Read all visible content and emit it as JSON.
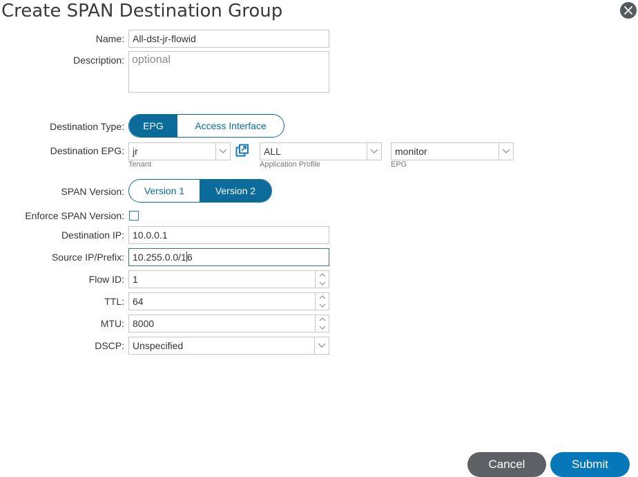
{
  "dialog": {
    "title": "Create SPAN Destination Group"
  },
  "form": {
    "name": {
      "label": "Name:",
      "value": "All-dst-jr-flowid"
    },
    "description": {
      "label": "Description:",
      "placeholder": "optional"
    },
    "destination_type": {
      "label": "Destination Type:",
      "options": [
        "EPG",
        "Access Interface"
      ],
      "selected": "EPG"
    },
    "destination_epg": {
      "label": "Destination EPG:",
      "tenant": {
        "value": "jr",
        "sublabel": "Tenant"
      },
      "app_profile": {
        "value": "ALL",
        "sublabel": "Application Profile"
      },
      "epg": {
        "value": "monitor",
        "sublabel": "EPG"
      }
    },
    "span_version": {
      "label": "SPAN Version:",
      "options": [
        "Version 1",
        "Version 2"
      ],
      "selected": "Version 2"
    },
    "enforce_span_version": {
      "label": "Enforce SPAN Version:",
      "checked": false
    },
    "destination_ip": {
      "label": "Destination IP:",
      "value": "10.0.0.1"
    },
    "source_ip_prefix": {
      "label": "Source IP/Prefix:",
      "value_before_cursor": "10.255.0.0/1",
      "value_after_cursor": "6"
    },
    "flow_id": {
      "label": "Flow ID:",
      "value": "1"
    },
    "ttl": {
      "label": "TTL:",
      "value": "64"
    },
    "mtu": {
      "label": "MTU:",
      "value": "8000"
    },
    "dscp": {
      "label": "DSCP:",
      "value": "Unspecified"
    }
  },
  "footer": {
    "cancel_label": "Cancel",
    "submit_label": "Submit"
  },
  "colors": {
    "accent": "#0b6b9a",
    "submit": "#0677b9",
    "cancel": "#5d6165"
  }
}
